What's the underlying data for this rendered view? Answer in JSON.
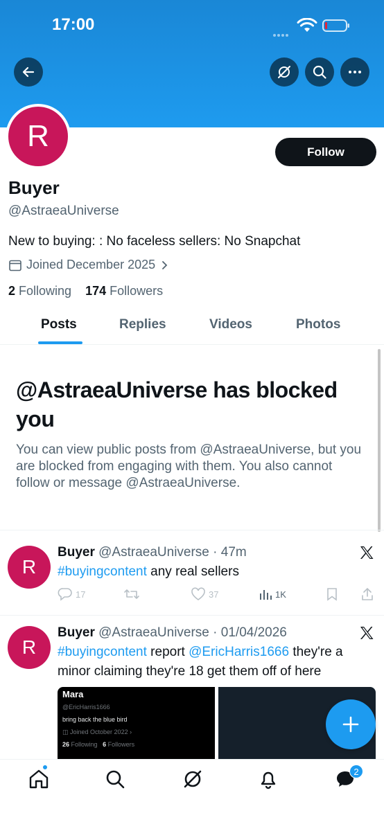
{
  "status_bar": {
    "time": "17:00"
  },
  "profile": {
    "avatar_letter": "R",
    "name": "Buyer",
    "handle": "@AstraeaUniverse",
    "bio": "New to buying: : No faceless sellers: No Snapchat",
    "joined": "Joined December 2025",
    "following_count": "2",
    "following_label": "Following",
    "followers_count": "174",
    "followers_label": "Followers",
    "follow_label": "Follow"
  },
  "tabs": [
    {
      "label": "Posts"
    },
    {
      "label": "Replies"
    },
    {
      "label": "Videos"
    },
    {
      "label": "Photos"
    }
  ],
  "blocked": {
    "title": "@AstraeaUniverse has blocked you",
    "body": "You can view public posts from @AstraeaUniverse, but you are blocked from engaging with them. You also cannot follow or message @AstraeaUniverse."
  },
  "posts": [
    {
      "avatar_letter": "R",
      "name": "Buyer",
      "handle": "@AstraeaUniverse",
      "time": "47m",
      "hashtag": "#buyingcontent",
      "text": " any real sellers",
      "replies": "17",
      "likes": "37",
      "views": "1K"
    },
    {
      "avatar_letter": "R",
      "name": "Buyer",
      "handle": "@AstraeaUniverse",
      "time": "01/04/2026",
      "hashtag": "#buyingcontent",
      "text_a": " report ",
      "mention": "@EricHarris1666",
      "text_b": " they're a minor claiming they're 18 get them off of here",
      "media": {
        "name": "Mara",
        "handle": "@EricHarris1666",
        "bio": "bring back the blue bird",
        "joined": "Joined October 2022",
        "following_count": "26",
        "following_label": "Following",
        "followers_count": "6",
        "followers_label": "Followers"
      }
    }
  ],
  "bottom_nav": {
    "messages_badge": "2"
  },
  "colors": {
    "accent": "#1d9bf0",
    "banner": "#1e9bef",
    "avatar": "#c8165a"
  }
}
